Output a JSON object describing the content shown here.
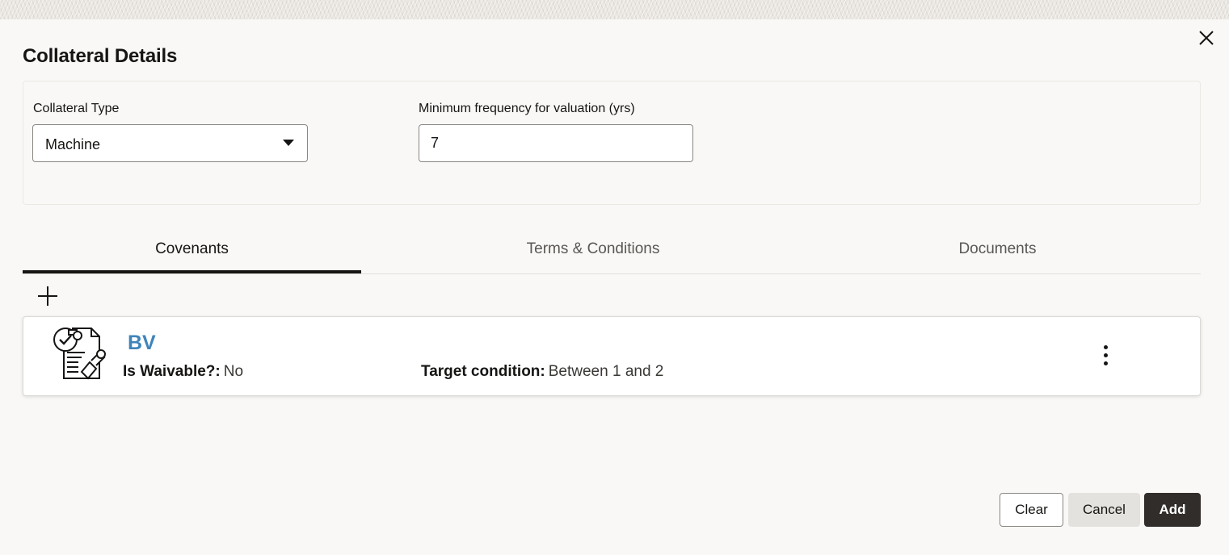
{
  "dialog": {
    "title": "Collateral Details",
    "close_icon": "close-icon"
  },
  "form": {
    "collateral_type": {
      "label": "Collateral Type",
      "value": "Machine"
    },
    "min_frequency": {
      "label": "Minimum frequency for valuation (yrs)",
      "value": "7"
    }
  },
  "tabs": [
    {
      "label": "Covenants",
      "active": true
    },
    {
      "label": "Terms & Conditions",
      "active": false
    },
    {
      "label": "Documents",
      "active": false
    }
  ],
  "covenant_list": {
    "add_icon": "plus-icon",
    "items": [
      {
        "icon": "document-checklist-icon",
        "name": "BV",
        "waivable_label": "Is Waivable?:",
        "waivable_value": "No",
        "target_label": "Target condition:",
        "target_value": "Between 1 and 2",
        "menu_icon": "kebab-menu-icon"
      }
    ]
  },
  "footer": {
    "clear_label": "Clear",
    "cancel_label": "Cancel",
    "add_label": "Add"
  },
  "colors": {
    "accent_link": "#3f84b9",
    "primary_button": "#312d2a",
    "background": "#f9f8f6"
  }
}
